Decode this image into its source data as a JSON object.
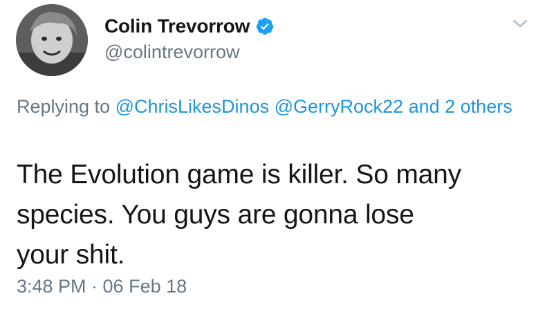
{
  "user": {
    "display_name": "Colin Trevorrow",
    "handle": "@colintrevorrow",
    "verified": true,
    "avatar_icon": "profile-photo"
  },
  "menu": {
    "icon": "chevron-down-icon"
  },
  "reply": {
    "prefix": "Replying to",
    "mention_1": "@ChrisLikesDinos",
    "mention_2": "@GerryRock22",
    "others": "and 2 others"
  },
  "tweet": {
    "line_1": "The Evolution game is killer. So many",
    "line_2": "species. You guys are gonna lose",
    "line_3": "your shit.",
    "timestamp": "3:48 PM · 06 Feb 18"
  },
  "colors": {
    "link": "#1b95e0",
    "secondary_text": "#657786",
    "primary_text": "#14171a",
    "verified_badge": "#1da1f2"
  }
}
